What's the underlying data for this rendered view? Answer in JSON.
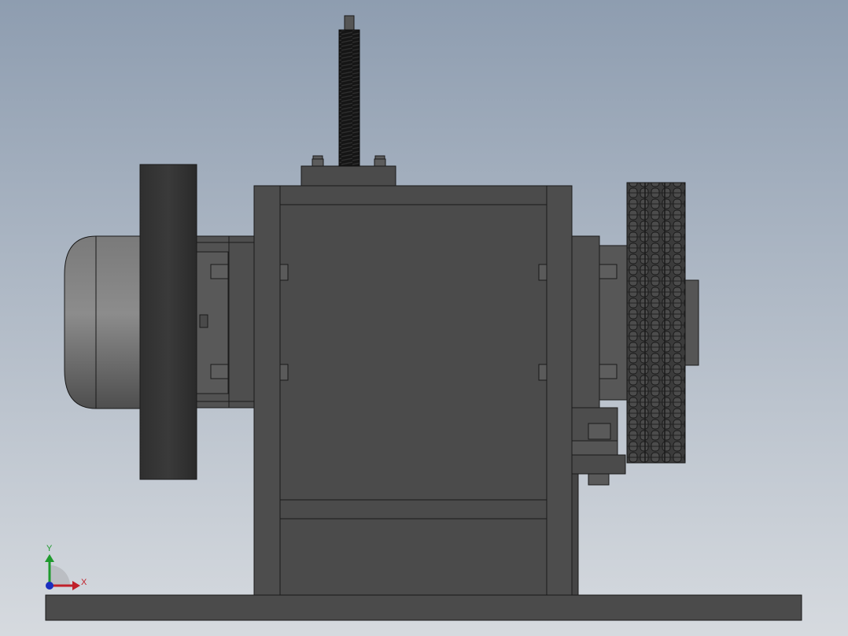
{
  "viewport": {
    "background_top": "#8e9db0",
    "background_bottom": "#d6dadf"
  },
  "model": {
    "body_color": "#4b4b4b",
    "edge_color": "#1a1a1a",
    "motor_color": "#6a6a6a",
    "chain_color": "#3a3a3a",
    "thread_color": "#111111"
  },
  "axis_triad": {
    "x_label": "X",
    "y_label": "Y",
    "x_color": "#c0202a",
    "y_color": "#1f9a2e",
    "z_color": "#1a2fbf"
  }
}
